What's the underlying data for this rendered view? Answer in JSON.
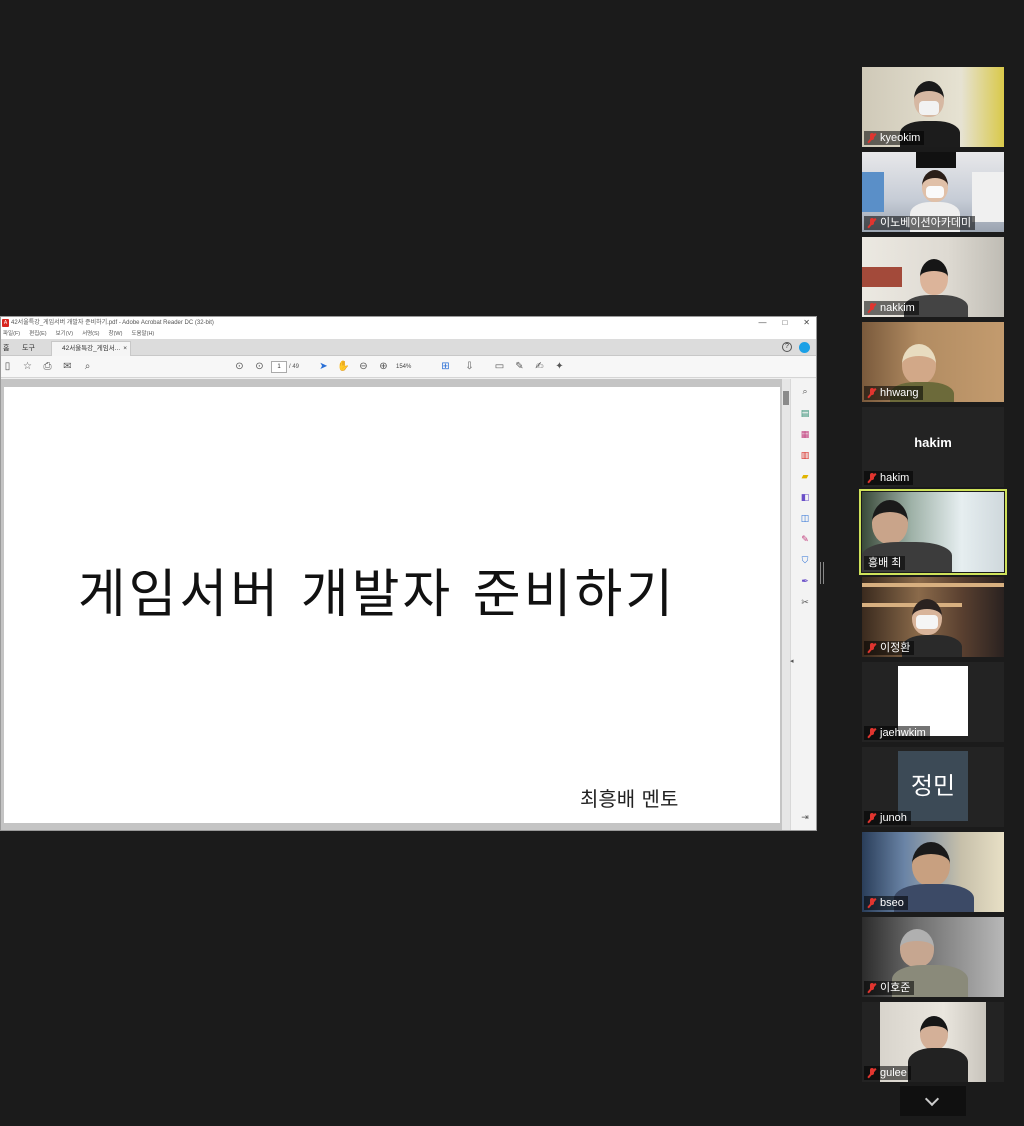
{
  "pdf_window": {
    "title": "42서울특강_게임서버 개발자 준비하기.pdf - Adobe Acrobat Reader DC (32-bit)",
    "app_icon_letter": "A",
    "window_controls": [
      "—",
      "□",
      "✕"
    ],
    "menu": [
      "파일(F)",
      "편집(E)",
      "보기(V)",
      "서명(S)",
      "창(W)",
      "도움말(H)"
    ],
    "nav_tabs": [
      "홈",
      "도구"
    ],
    "doc_tab_label": "42서울특강_게임서...",
    "doc_tab_close": "×",
    "help_label": "?",
    "toolbar": {
      "current_page": "1",
      "total_pages": "/ 49",
      "zoom": "154%"
    },
    "slide": {
      "title": "게임서버 개발자 준비하기",
      "author": "최흥배 멘토"
    }
  },
  "participants": [
    {
      "name": "kyeokim"
    },
    {
      "name": "이노베이션아카데미"
    },
    {
      "name": "nakkim"
    },
    {
      "name": "hhwang"
    },
    {
      "name": "hakim",
      "avatar_text": "hakim"
    },
    {
      "name": "홍배 최"
    },
    {
      "name": "이정환"
    },
    {
      "name": "jaehwkim"
    },
    {
      "name": "junoh",
      "avatar_text": "정민"
    },
    {
      "name": "bseo"
    },
    {
      "name": "이호준"
    },
    {
      "name": "gulee"
    }
  ],
  "colors": {
    "background": "#1b1b1b",
    "active_speaker_border": "#cfe25a",
    "mic_muted": "#e0352f",
    "acrobat_red": "#d8261f"
  }
}
